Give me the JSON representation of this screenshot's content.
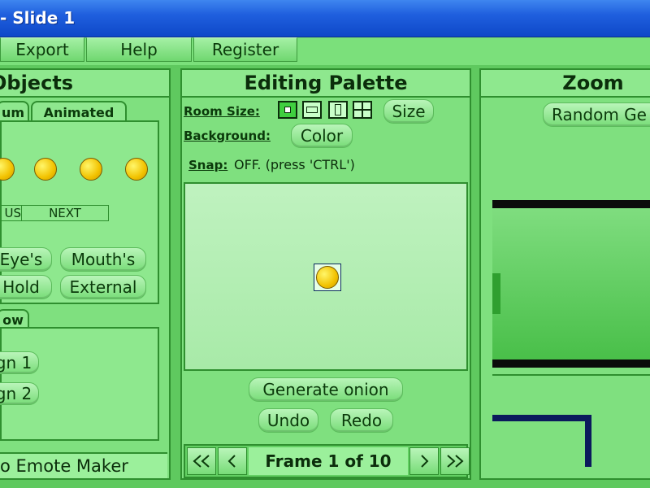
{
  "window": {
    "title": "- Slide 1"
  },
  "menu": {
    "export": "Export",
    "help": "Help",
    "register": "Register"
  },
  "objects_panel": {
    "title": "Objects",
    "tabs": {
      "custom": "um",
      "animated": "Animated"
    },
    "nav": {
      "prev": "US",
      "next": "NEXT"
    },
    "buttons": {
      "eyes": "Eye's",
      "mouths": "Mouth's",
      "hold": "Hold",
      "external": "External"
    },
    "lower_tab": "ow",
    "lower_items": [
      "gn 1",
      "gn 2"
    ],
    "footer": "o Emote Maker"
  },
  "editing_palette": {
    "title": "Editing Palette",
    "room_size_label": "Room Size:",
    "size_button": "Size",
    "background_label": "Background:",
    "color_button": "Color",
    "snap_label": "Snap:",
    "snap_status": "OFF. (press 'CTRL')",
    "generate_onion": "Generate onion",
    "undo": "Undo",
    "redo": "Redo",
    "frame_text": "Frame 1 of 10",
    "frame_icons": [
      "double-left-arrow-icon",
      "left-arrow-icon",
      "right-arrow-icon",
      "double-right-arrow-icon"
    ]
  },
  "zoom_panel": {
    "title": "Zoom",
    "random_button": "Random Ge"
  },
  "colors": {
    "title_bar": "#1f5fde",
    "panel_bg": "#7fe07f",
    "panel_border": "#2f8f2f",
    "emote_yellow": "#f2c200",
    "dark_navy": "#0b1a5c"
  }
}
